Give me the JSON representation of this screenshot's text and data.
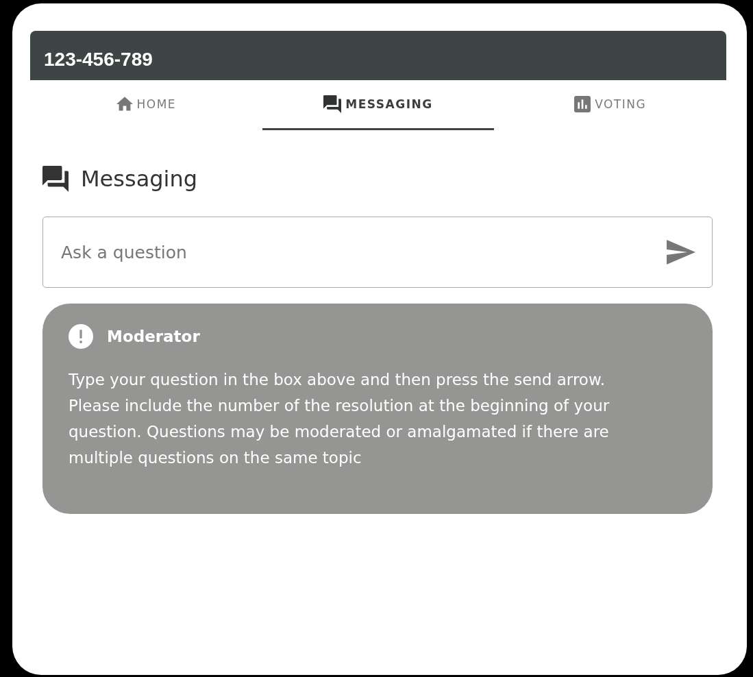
{
  "header": {
    "title": "123-456-789"
  },
  "tabs": [
    {
      "label": "HOME",
      "selected": false
    },
    {
      "label": "MESSAGING",
      "selected": true
    },
    {
      "label": "VOTING",
      "selected": false
    }
  ],
  "section": {
    "title": "Messaging"
  },
  "question_field": {
    "placeholder": "Ask a question"
  },
  "notice": {
    "author": "Moderator",
    "text": "Type your question in the box above and then press the send arrow. Please include the number of the resolution at the beginning of your question. Questions may be moderated or amalgamated if there are multiple questions on the same topic"
  }
}
